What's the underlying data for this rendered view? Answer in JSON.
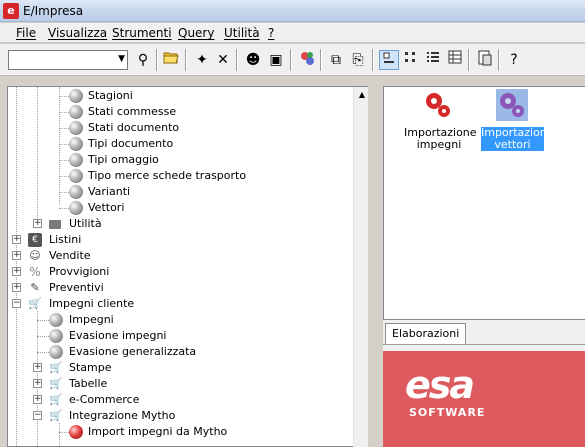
{
  "window": {
    "title": "E/Impresa",
    "app_icon": "e-app-icon"
  },
  "menu": [
    {
      "label": "File"
    },
    {
      "label": "Visualizza"
    },
    {
      "label": "Strumenti"
    },
    {
      "label": "Query"
    },
    {
      "label": "Utilità"
    },
    {
      "label": "?"
    }
  ],
  "toolbar": {
    "combo_value": "",
    "buttons": [
      "binoculars-icon",
      "open-folder-icon",
      "new-item-icon",
      "delete-icon",
      "users-icon",
      "user-card-icon",
      "gears-icon",
      "copy-icon",
      "move-icon",
      "large-icons-view-icon",
      "small-icons-view-icon",
      "list-view-icon",
      "details-view-icon",
      "properties-icon",
      "help-icon"
    ]
  },
  "tree": {
    "items": [
      {
        "label": "Stagioni",
        "icon": "sphere-icon"
      },
      {
        "label": "Stati commesse",
        "icon": "sphere-icon"
      },
      {
        "label": "Stati documento",
        "icon": "sphere-icon"
      },
      {
        "label": "Tipi documento",
        "icon": "sphere-icon"
      },
      {
        "label": "Tipi omaggio",
        "icon": "sphere-icon"
      },
      {
        "label": "Tipo merce schede trasporto",
        "icon": "sphere-icon"
      },
      {
        "label": "Varianti",
        "icon": "sphere-icon"
      },
      {
        "label": "Vettori",
        "icon": "sphere-icon"
      },
      {
        "label": "Utilità",
        "icon": "toolbox-icon",
        "expander": "+"
      },
      {
        "label": "Listini",
        "icon": "price-list-icon",
        "expander": "+"
      },
      {
        "label": "Vendite",
        "icon": "sales-icon",
        "expander": "+"
      },
      {
        "label": "Provvigioni",
        "icon": "commission-icon",
        "expander": "+"
      },
      {
        "label": "Preventivi",
        "icon": "quote-icon",
        "expander": "+"
      },
      {
        "label": "Impegni cliente",
        "icon": "cart-icon",
        "expander": "−"
      },
      {
        "label": "Impegni",
        "icon": "sphere-icon"
      },
      {
        "label": "Evasione impegni",
        "icon": "sphere-icon"
      },
      {
        "label": "Evasione generalizzata",
        "icon": "sphere-icon"
      },
      {
        "label": "Stampe",
        "icon": "cart-icon",
        "expander": "+"
      },
      {
        "label": "Tabelle",
        "icon": "cart-icon",
        "expander": "+"
      },
      {
        "label": "e-Commerce",
        "icon": "cart-icon",
        "expander": "+"
      },
      {
        "label": "Integrazione Mytho",
        "icon": "cart-icon",
        "expander": "−"
      },
      {
        "label": "Import impegni da Mytho",
        "icon": "red-sphere-icon"
      }
    ]
  },
  "elaborazioni": {
    "items": [
      {
        "line1": "Importazione",
        "line2": "impegni",
        "icon": "red-gears-icon",
        "selected": false
      },
      {
        "line1": "Importazione",
        "line2": "vettori",
        "icon": "purple-gears-icon",
        "selected": true
      }
    ],
    "tab_label": "Elaborazioni"
  },
  "logo": {
    "word": "esa",
    "sub": "SOFTWARE",
    "bg_color": "#dd5a5e"
  }
}
